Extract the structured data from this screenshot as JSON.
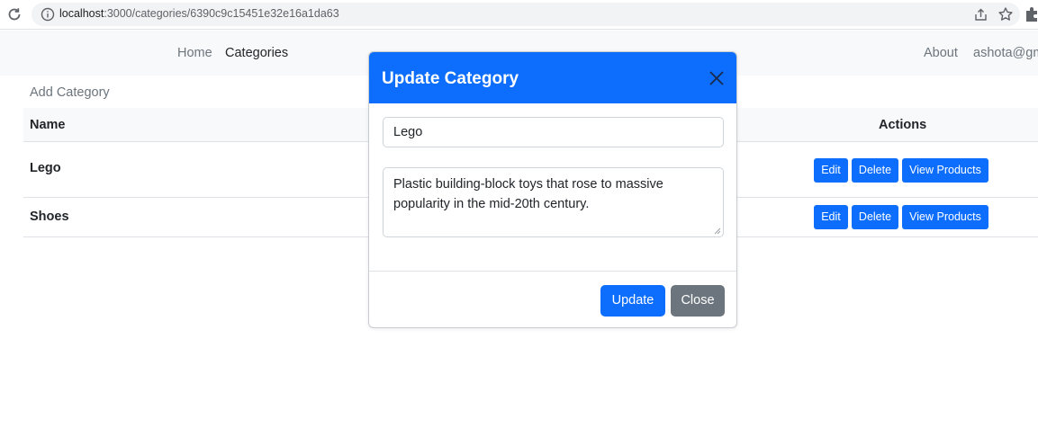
{
  "browser": {
    "url_host": "localhost",
    "url_path": ":3000/categories/6390c9c15451e32e16a1da63"
  },
  "navbar": {
    "home": "Home",
    "categories": "Categories",
    "about": "About",
    "user": "ashota@gm"
  },
  "page": {
    "add_category": "Add Category",
    "columns": {
      "name": "Name",
      "actions": "Actions"
    },
    "rows": [
      {
        "name": "Lego",
        "edit": "Edit",
        "delete": "Delete",
        "view": "View Products"
      },
      {
        "name": "Shoes",
        "edit": "Edit",
        "delete": "Delete",
        "view": "View Products"
      }
    ]
  },
  "modal": {
    "title": "Update Category",
    "name_value": "Lego",
    "description_value": "Plastic building-block toys that rose to massive popularity in the mid-20th century.",
    "update_label": "Update",
    "close_label": "Close"
  },
  "colors": {
    "primary": "#0d6efd",
    "secondary": "#6c757d",
    "navbar_bg": "#f8f9fa"
  }
}
